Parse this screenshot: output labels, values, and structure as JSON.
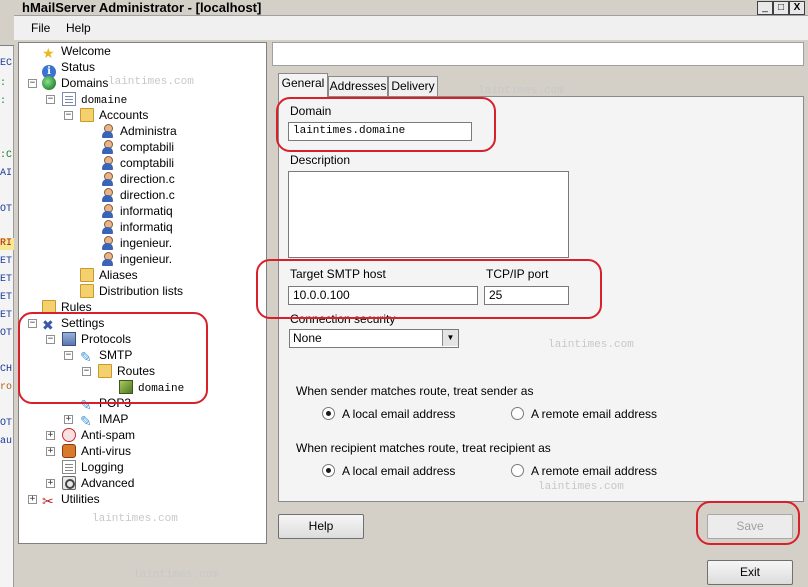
{
  "window": {
    "title": "hMailServer Administrator - [localhost]",
    "controls": {
      "minimize": "_",
      "maximize": "□",
      "close": "X"
    }
  },
  "menu": {
    "items": [
      "File",
      "Help"
    ]
  },
  "background_strip": {
    "lines": [
      "EC",
      ":",
      ":",
      ":C",
      "AI",
      "OT",
      "RI",
      "ET",
      "ET",
      "ET",
      "ET",
      "OT",
      "CH",
      "ro",
      "OT",
      "au"
    ]
  },
  "tree": {
    "welcome": "Welcome",
    "status": "Status",
    "domains": "Domains",
    "domain_name": "domaine",
    "accounts": "Accounts",
    "account_items": [
      "Administra",
      "comptabili",
      "comptabili",
      "direction.c",
      "direction.c",
      "informatiq",
      "informatiq",
      "ingenieur.",
      "ingenieur."
    ],
    "aliases": "Aliases",
    "distribution_lists": "Distribution lists",
    "rules": "Rules",
    "settings": "Settings",
    "protocols": "Protocols",
    "smtp": "SMTP",
    "routes": "Routes",
    "route_item": "domaine",
    "pop3": "POP3",
    "imap": "IMAP",
    "antispam": "Anti-spam",
    "antivirus": "Anti-virus",
    "logging": "Logging",
    "advanced": "Advanced",
    "utilities": "Utilities",
    "expanders": {
      "minus": "−",
      "plus": "+"
    }
  },
  "tabs": [
    "General",
    "Addresses",
    "Delivery"
  ],
  "form": {
    "domain_label": "Domain",
    "domain_value": "laintimes.domaine",
    "description_label": "Description",
    "description_value": "",
    "target_smtp_label": "Target SMTP host",
    "target_smtp_value": "10.0.0.100",
    "tcpip_port_label": "TCP/IP port",
    "tcpip_port_value": "25",
    "connection_security_label": "Connection security",
    "connection_security_value": "None",
    "sender_group_label": "When sender matches route, treat sender as",
    "sender_options": [
      "A local email address",
      "A remote email address"
    ],
    "sender_selected": 0,
    "recipient_group_label": "When recipient matches route, treat recipient as",
    "recipient_options": [
      "A local email address",
      "A remote email address"
    ],
    "recipient_selected": 0
  },
  "buttons": {
    "help": "Help",
    "save": "Save",
    "exit": "Exit"
  },
  "watermark": "laintimes.com",
  "colors": {
    "callout": "#d8202a",
    "window_bg": "#d4d0c8"
  }
}
